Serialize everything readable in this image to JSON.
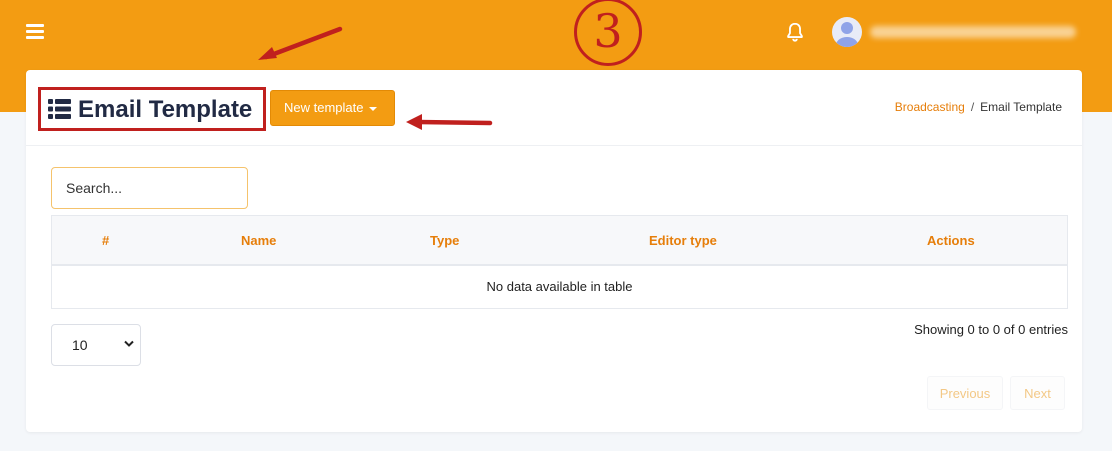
{
  "topbar": {
    "background_color": "#f39c12",
    "menu_icon": "hamburger-menu-icon",
    "step_annotation": "3",
    "notification_icon": "bell-icon",
    "avatar_icon": "user-avatar-icon",
    "username_blurred": true
  },
  "header": {
    "title": "Email Template",
    "title_icon": "list-icon",
    "new_button_label": "New template",
    "breadcrumb": {
      "parent": "Broadcasting",
      "separator": "/",
      "current": "Email Template"
    }
  },
  "annotations": {
    "highlight_color": "#c0201e"
  },
  "search": {
    "placeholder": "Search..."
  },
  "table": {
    "columns": [
      "#",
      "Name",
      "Type",
      "Editor type",
      "Actions"
    ],
    "empty_message": "No data available in table"
  },
  "footer": {
    "page_size": "10",
    "info": "Showing 0 to 0 of 0 entries",
    "previous_label": "Previous",
    "next_label": "Next"
  }
}
